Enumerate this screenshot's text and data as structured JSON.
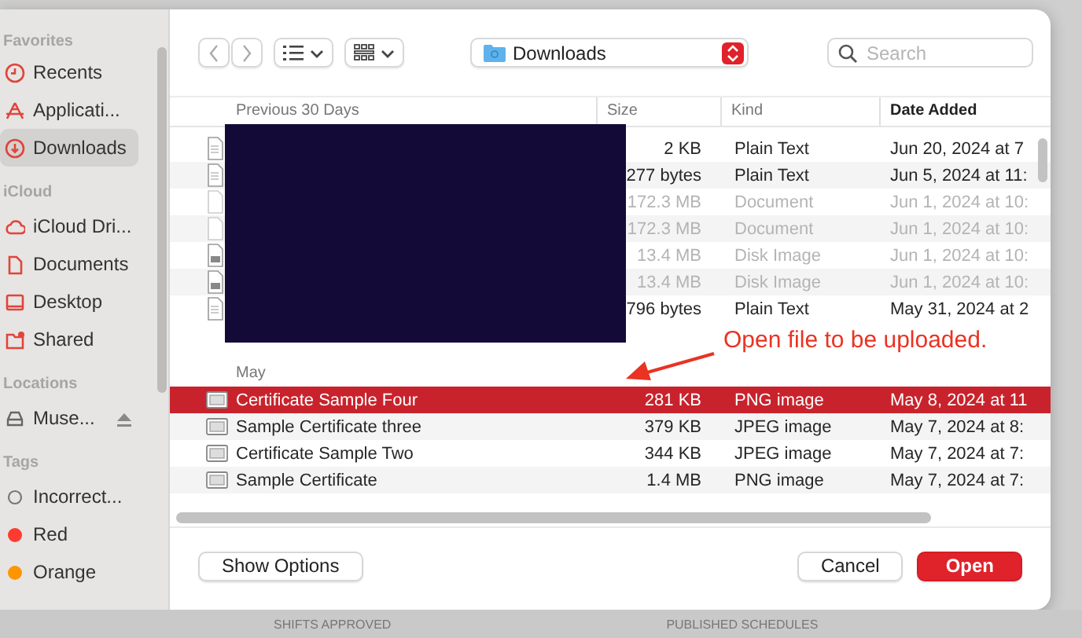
{
  "sidebar": {
    "sections": [
      {
        "title": "Favorites",
        "items": [
          {
            "label": "Recents",
            "kind": "clock",
            "selected": false
          },
          {
            "label": "Applicati...",
            "kind": "apps",
            "selected": false
          },
          {
            "label": "Downloads",
            "kind": "download",
            "selected": true
          }
        ]
      },
      {
        "title": "iCloud",
        "items": [
          {
            "label": "iCloud Dri...",
            "kind": "cloud",
            "selected": false
          },
          {
            "label": "Documents",
            "kind": "document",
            "selected": false
          },
          {
            "label": "Desktop",
            "kind": "desktop",
            "selected": false
          },
          {
            "label": "Shared",
            "kind": "shared",
            "selected": false
          }
        ]
      },
      {
        "title": "Locations",
        "items": [
          {
            "label": "Muse...",
            "kind": "drive",
            "selected": false,
            "ejectable": true
          }
        ]
      },
      {
        "title": "Tags",
        "items": [
          {
            "label": "Incorrect...",
            "kind": "tag-outline",
            "selected": false
          },
          {
            "label": "Red",
            "kind": "tag",
            "color": "#ff3b30",
            "selected": false
          },
          {
            "label": "Orange",
            "kind": "tag",
            "color": "#ff9500",
            "selected": false
          }
        ]
      }
    ]
  },
  "toolbar": {
    "location": "Downloads",
    "search": {
      "placeholder": "Search"
    }
  },
  "columns": [
    {
      "label": "Previous 30 Days",
      "sorted": false
    },
    {
      "label": "Size",
      "sorted": false
    },
    {
      "label": "Kind",
      "sorted": false
    },
    {
      "label": "Date Added",
      "sorted": true
    }
  ],
  "groups": [
    {
      "rows": [
        {
          "kind": "text",
          "size": "2 KB",
          "file_kind": "Plain Text",
          "date": "Jun 20, 2024 at 7",
          "selected": false,
          "disabled": false
        },
        {
          "kind": "text",
          "size": "277 bytes",
          "file_kind": "Plain Text",
          "date": "Jun 5, 2024 at 11:",
          "selected": false,
          "disabled": false
        },
        {
          "kind": "document",
          "size": "172.3 MB",
          "file_kind": "Document",
          "date": "Jun 1, 2024 at 10:",
          "selected": false,
          "disabled": true
        },
        {
          "kind": "document",
          "size": "172.3 MB",
          "file_kind": "Document",
          "date": "Jun 1, 2024 at 10:",
          "selected": false,
          "disabled": true
        },
        {
          "kind": "disk",
          "size": "13.4 MB",
          "file_kind": "Disk Image",
          "date": "Jun 1, 2024 at 10:",
          "selected": false,
          "disabled": true
        },
        {
          "kind": "disk",
          "size": "13.4 MB",
          "file_kind": "Disk Image",
          "date": "Jun 1, 2024 at 10:",
          "selected": false,
          "disabled": true
        },
        {
          "kind": "text",
          "size": "796 bytes",
          "file_kind": "Plain Text",
          "date": "May 31, 2024 at 2",
          "selected": false,
          "disabled": false
        }
      ]
    },
    {
      "label": "May",
      "rows": [
        {
          "kind": "image",
          "name": "Certificate Sample Four",
          "size": "281 KB",
          "file_kind": "PNG image",
          "date": "May 8, 2024 at 11",
          "selected": true,
          "disabled": false
        },
        {
          "kind": "image",
          "name": "Sample Certificate three",
          "size": "379 KB",
          "file_kind": "JPEG image",
          "date": "May 7, 2024 at 8:",
          "selected": false,
          "disabled": false
        },
        {
          "kind": "image",
          "name": "Certificate Sample Two",
          "size": "344 KB",
          "file_kind": "JPEG image",
          "date": "May 7, 2024 at 7:",
          "selected": false,
          "disabled": false
        },
        {
          "kind": "image",
          "name": "Sample Certificate",
          "size": "1.4 MB",
          "file_kind": "PNG image",
          "date": "May 7, 2024 at 7:",
          "selected": false,
          "disabled": false
        }
      ]
    }
  ],
  "annotation": {
    "text": "Open file to be uploaded."
  },
  "buttons": [
    {
      "label": "Show Options",
      "kind": "plain"
    },
    {
      "label": "Cancel",
      "kind": "plain"
    },
    {
      "label": "Open",
      "kind": "default"
    }
  ],
  "background": {
    "labels": [
      "SHIFTS APPROVED",
      "PUBLISHED SCHEDULES"
    ]
  }
}
